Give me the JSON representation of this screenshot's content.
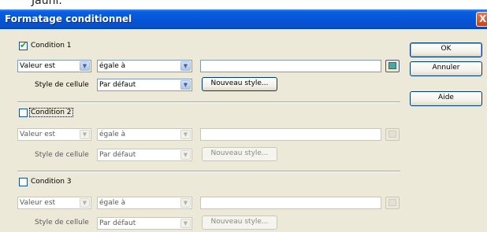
{
  "top_strip_text": "Jauni.",
  "dialog": {
    "title": "Formatage conditionnel",
    "close_glyph": "X"
  },
  "conditions": [
    {
      "label": "Condition 1",
      "checked": true,
      "value_type": "Valeur est",
      "operator": "égale à",
      "value": "",
      "style_label": "Style de cellule",
      "style_value": "Par défaut",
      "new_style_label": "Nouveau style..."
    },
    {
      "label": "Condition 2",
      "checked": false,
      "value_type": "Valeur est",
      "operator": "égale à",
      "value": "",
      "style_label": "Style de cellule",
      "style_value": "Par défaut",
      "new_style_label": "Nouveau style..."
    },
    {
      "label": "Condition 3",
      "checked": false,
      "value_type": "Valeur est",
      "operator": "égale à",
      "value": "",
      "style_label": "Style de cellule",
      "style_value": "Par défaut",
      "new_style_label": "Nouveau style..."
    }
  ],
  "buttons": {
    "ok": "OK",
    "cancel": "Annuler",
    "help": "Aide"
  },
  "icons": {
    "checkmark": "check-icon",
    "dropdown": "chevron-down-icon",
    "picker": "shrink-dialog-icon"
  },
  "colors": {
    "titlebar": "#0554d8",
    "dialog_bg": "#ece9d8",
    "check": "#21a121",
    "close": "#c8401c"
  }
}
